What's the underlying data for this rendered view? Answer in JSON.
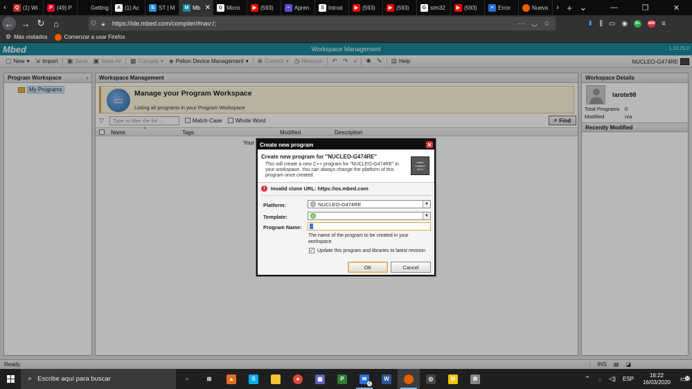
{
  "browser": {
    "tabs": [
      {
        "label": "(1) Wi",
        "icon": "quora-icon",
        "color": "#b92b27",
        "glyph": "Q"
      },
      {
        "label": "(49) P",
        "icon": "pinterest-icon",
        "color": "#e60023",
        "glyph": "P"
      },
      {
        "label": "Getting Sta",
        "icon": "",
        "color": "#0c0c0d",
        "glyph": ""
      },
      {
        "label": "(1) Ac",
        "icon": "app-icon",
        "color": "#ffffff",
        "glyph": "A"
      },
      {
        "label": "ST | M",
        "icon": "st-icon",
        "color": "#2a8fd6",
        "glyph": "S"
      },
      {
        "label": "Mb",
        "icon": "mbed-icon",
        "color": "#1a8a9a",
        "glyph": "M",
        "active": true
      },
      {
        "label": "Micro",
        "icon": "google-icon",
        "color": "#ffffff",
        "glyph": "G"
      },
      {
        "label": "(593)",
        "icon": "youtube-icon",
        "color": "#ff0000",
        "glyph": "▶"
      },
      {
        "label": "Apren",
        "icon": "page-icon",
        "color": "#5a4fcf",
        "glyph": "~"
      },
      {
        "label": "Introd",
        "icon": "page-icon",
        "color": "#ffffff",
        "glyph": "S"
      },
      {
        "label": "(593)",
        "icon": "youtube-icon",
        "color": "#ff0000",
        "glyph": "▶"
      },
      {
        "label": "(593)",
        "icon": "youtube-icon",
        "color": "#ff0000",
        "glyph": "▶"
      },
      {
        "label": "stm32",
        "icon": "google-icon",
        "color": "#ffffff",
        "glyph": "G"
      },
      {
        "label": "(593)",
        "icon": "youtube-icon",
        "color": "#ff0000",
        "glyph": "▶"
      },
      {
        "label": "Error",
        "icon": "page-icon",
        "color": "#2a6fd6",
        "glyph": "≡"
      },
      {
        "label": "Nueva",
        "icon": "firefox-icon",
        "color": "#e66000",
        "glyph": ""
      }
    ],
    "url": "https://ide.mbed.com/compiler/#nav:/;",
    "bookmarks": {
      "most_visited": "Más visitados",
      "get_started": "Comenzar a usar Firefox"
    }
  },
  "app": {
    "logo": "Mbed",
    "title": "Workspace Management",
    "version": "1.10.25.0",
    "toolbar": {
      "new": "New",
      "import": "Import",
      "save": "Save",
      "save_all": "Save All",
      "compile": "Compile",
      "pelion": "Pelion Device Management",
      "commit": "Commit",
      "revision": "Revision",
      "help": "Help"
    },
    "platform": "NUCLEO-G474RE",
    "left_panel": {
      "title": "Program Workspace",
      "item": "My Programs"
    },
    "center": {
      "title": "Workspace Management",
      "header_title": "Manage your Program Workspace",
      "header_sub": "Listing all programs in your Program Workspace",
      "filter_placeholder": "Type to filter the list ...",
      "match_case": "Match Case",
      "whole_word": "Whole Word",
      "find": "Find",
      "columns": {
        "name": "Name",
        "tags": "Tags",
        "modified": "Modified",
        "description": "Description"
      },
      "empty_text": "Your"
    },
    "right_panel": {
      "title": "Workspace Details",
      "username": "larote98",
      "total_programs_label": "Total Programs",
      "total_programs": "0",
      "modified_label": "Modified",
      "modified": "n/a",
      "recent_title": "Recently Modified"
    },
    "status": {
      "text": "Ready.",
      "ins": "INS"
    }
  },
  "dialog": {
    "title": "Create new program",
    "heading": "Create new program for \"NUCLEO-G474RE\"",
    "description": "This will create a new C++ program for \"NUCLEO-G474RE\" in your workspace. You can always change the platform of this program once created.",
    "chip_line1": "mbed enabled",
    "chip_line2": "MCU",
    "error": "Invalid clone URL: https://os.mbed.com",
    "platform_label": "Platform:",
    "platform_value": "NUCLEO-G474RE",
    "template_label": "Template:",
    "template_value": "",
    "name_label": "Program Name:",
    "name_value": "",
    "name_hint": "The name of the program to be created in your workspace",
    "update_label": "Update this program and libraries to latest revision",
    "update_checked": true,
    "ok": "OK",
    "cancel": "Cancel"
  },
  "taskbar": {
    "search_placeholder": "Escribe aquí para buscar",
    "apps": [
      {
        "name": "task-view",
        "color": "#1f1f1f",
        "glyph": "○"
      },
      {
        "name": "timeline",
        "color": "#1f1f1f",
        "glyph": "⊞"
      },
      {
        "name": "matlab",
        "color": "#e16d1f",
        "glyph": "▲"
      },
      {
        "name": "skype",
        "color": "#00aff0",
        "glyph": "S"
      },
      {
        "name": "explorer",
        "color": "#f2c233",
        "glyph": ""
      },
      {
        "name": "chrome",
        "color": "#dd4b39",
        "glyph": "●"
      },
      {
        "name": "calculator",
        "color": "#5b5fc7",
        "glyph": "▦"
      },
      {
        "name": "project",
        "color": "#2e7d32",
        "glyph": "P"
      },
      {
        "name": "mail",
        "color": "#2a6fd6",
        "glyph": "✉",
        "badge": "6"
      },
      {
        "name": "word",
        "color": "#2b579a",
        "glyph": "W"
      },
      {
        "name": "firefox",
        "color": "#e66000",
        "glyph": "",
        "active": true
      },
      {
        "name": "media",
        "color": "#444444",
        "glyph": "◎"
      },
      {
        "name": "mega",
        "color": "#f5c400",
        "glyph": "M"
      },
      {
        "name": "app",
        "color": "#888888",
        "glyph": "⚙"
      }
    ],
    "lang": "ESP",
    "time": "16:22",
    "date": "16/03/2020",
    "notifications": "12"
  }
}
